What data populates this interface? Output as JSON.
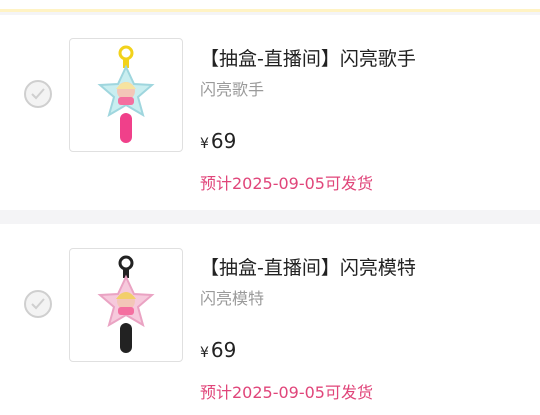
{
  "colors": {
    "accent_pink": "#e0457a",
    "text_dark": "#222222",
    "text_gray": "#9a9a9a",
    "page_bg": "#f4f4f6"
  },
  "items": [
    {
      "title": "【抽盒-直播间】闪亮歌手",
      "variant": "闪亮歌手",
      "currency": "¥",
      "price": "69",
      "shipping": "预计2025-09-05可发货",
      "selected": false,
      "image_icon": "keychain-star-singer-icon"
    },
    {
      "title": "【抽盒-直播间】闪亮模特",
      "variant": "闪亮模特",
      "currency": "¥",
      "price": "69",
      "shipping": "预计2025-09-05可发货",
      "selected": false,
      "image_icon": "keychain-star-model-icon"
    }
  ]
}
